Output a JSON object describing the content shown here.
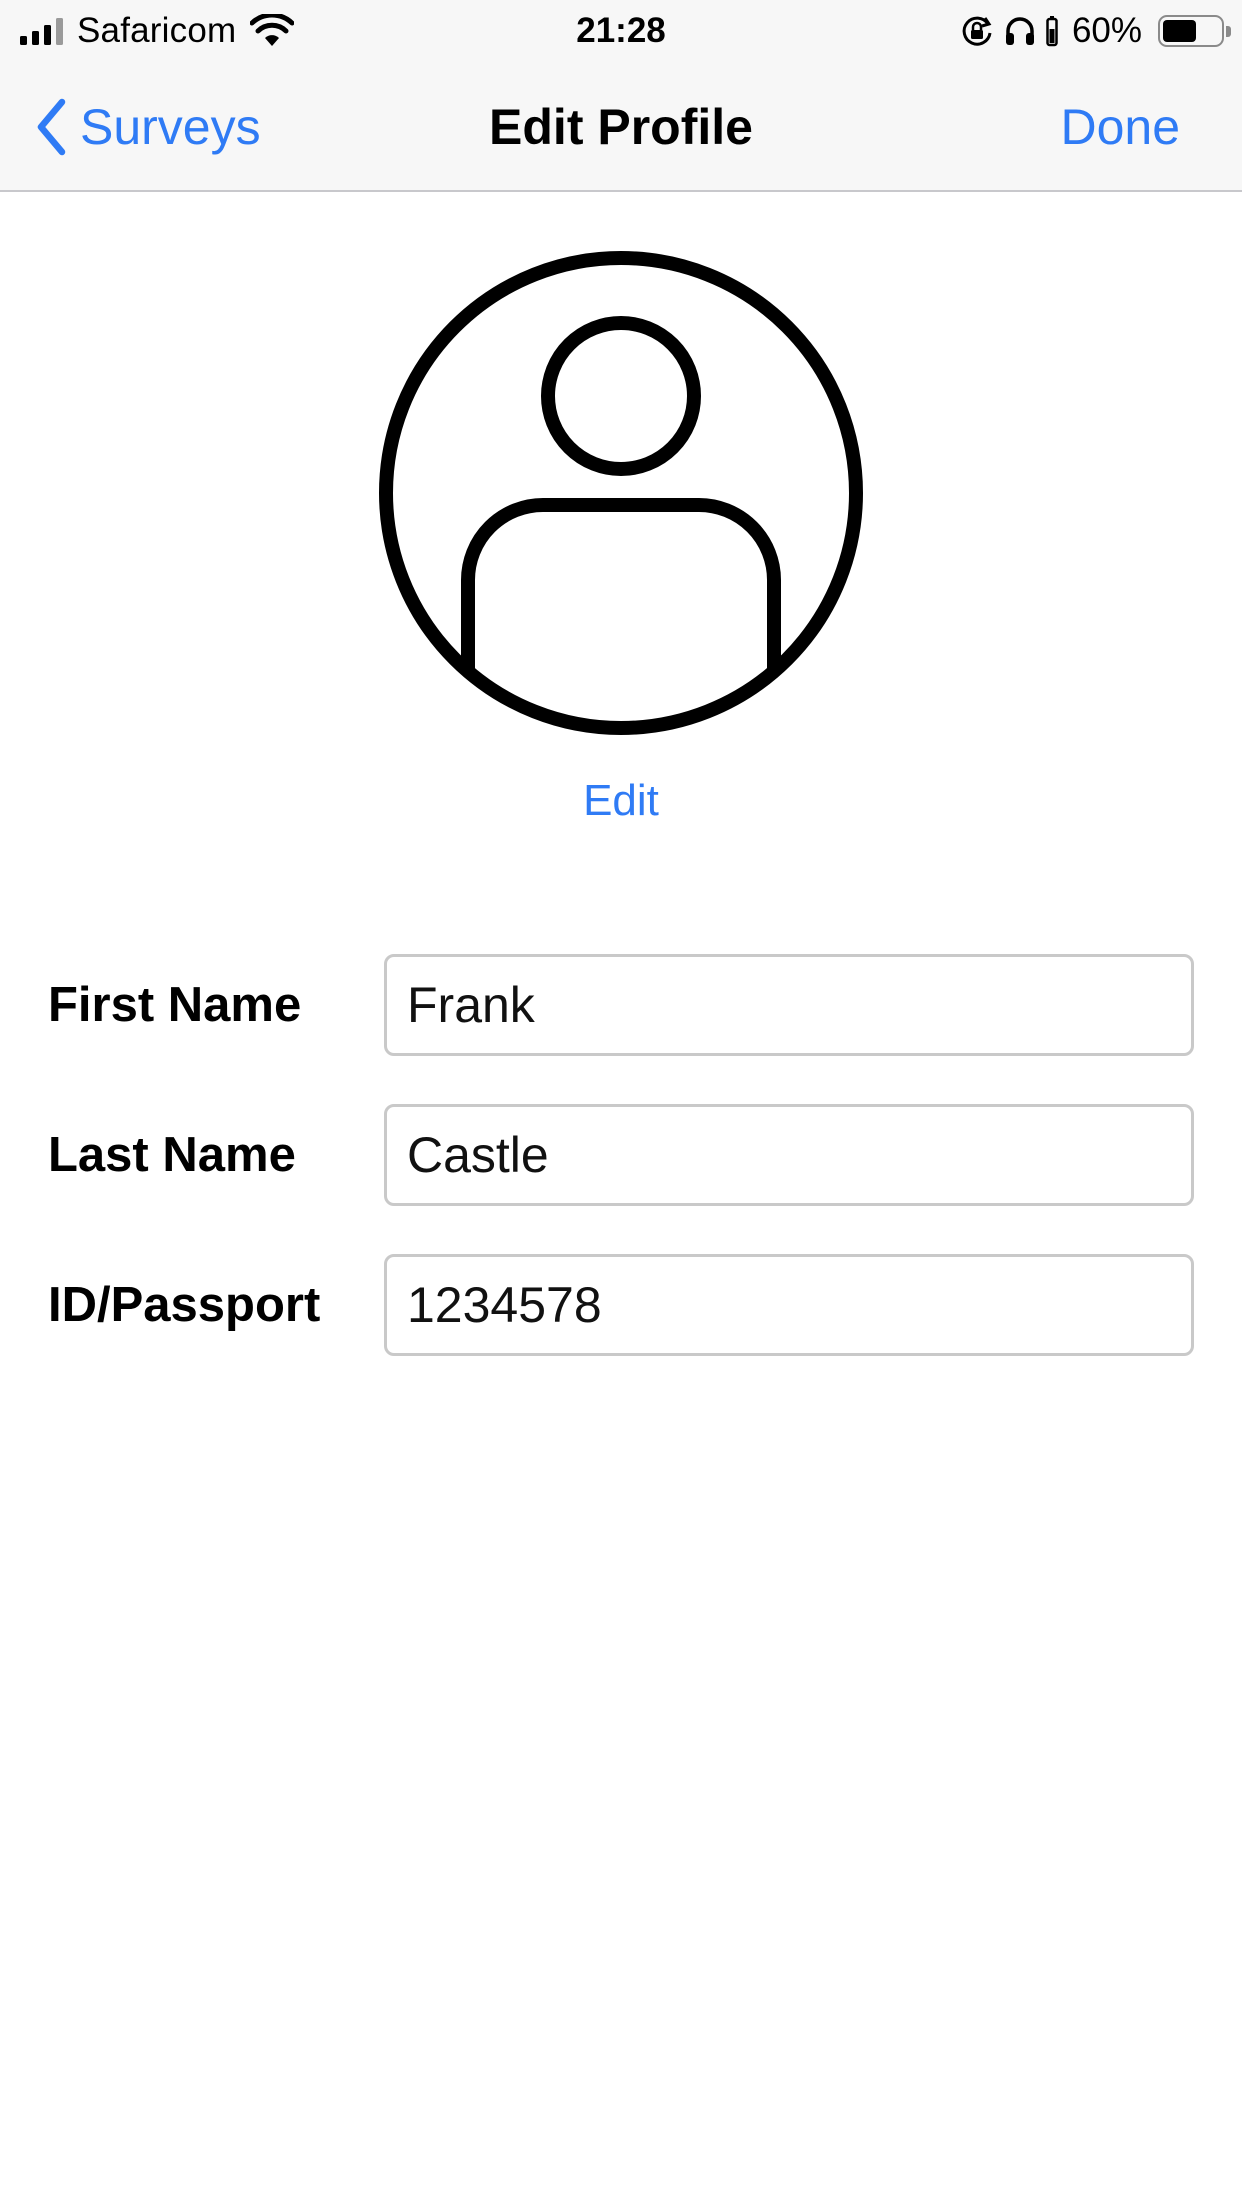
{
  "status_bar": {
    "carrier": "Safaricom",
    "time": "21:28",
    "battery_percent": "60%",
    "battery_level": 0.6,
    "icons": [
      "signal-icon",
      "wifi-icon",
      "orientation-lock-icon",
      "headphones-icon",
      "headphone-battery-icon",
      "battery-icon"
    ]
  },
  "nav": {
    "back_label": "Surveys",
    "title": "Edit Profile",
    "done_label": "Done",
    "accent_color": "#2f7bf5"
  },
  "avatar": {
    "icon": "person-placeholder-icon",
    "edit_label": "Edit"
  },
  "form": {
    "first_name": {
      "label": "First Name",
      "value": "Frank"
    },
    "last_name": {
      "label": "Last Name",
      "value": "Castle"
    },
    "id_passport": {
      "label": "ID/Passport",
      "value": "1234578"
    }
  }
}
